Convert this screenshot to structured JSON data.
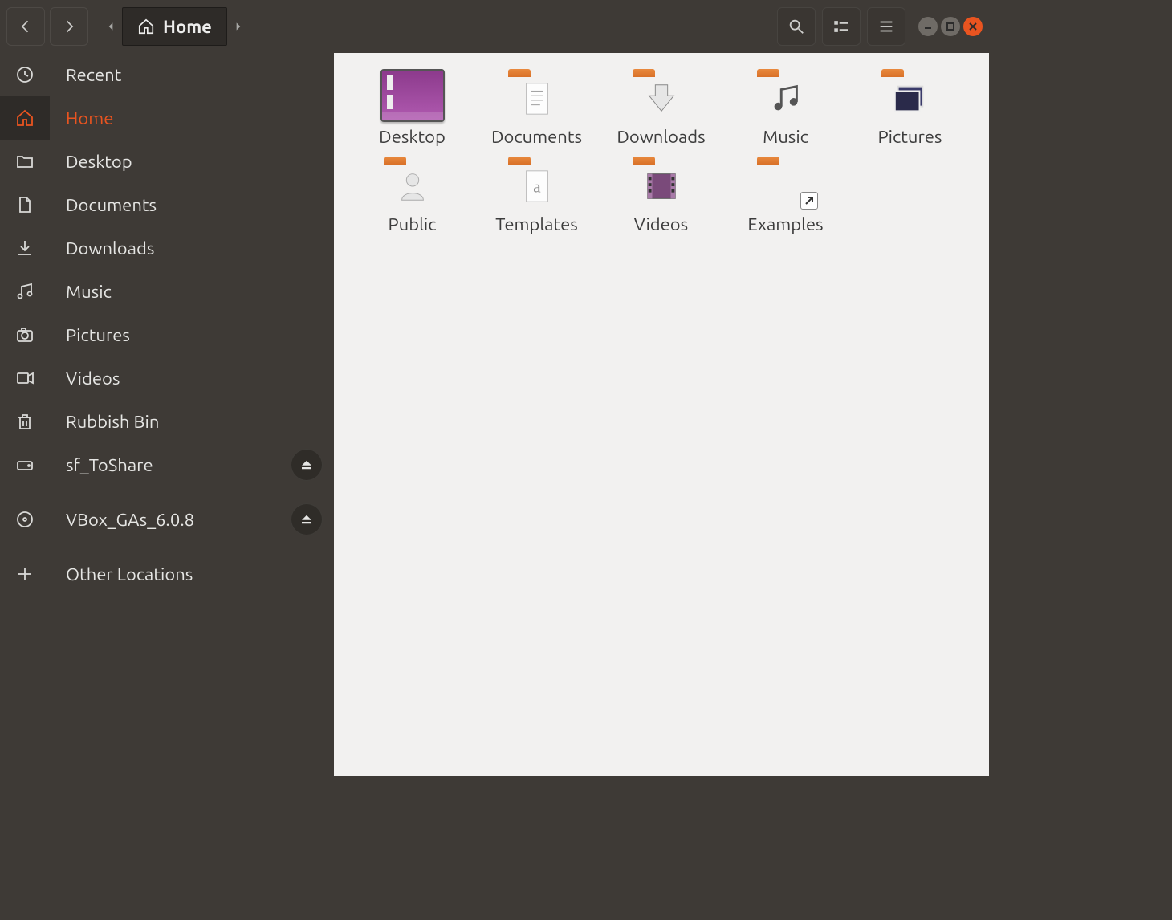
{
  "toolbar": {
    "path_segment": "Home"
  },
  "sidebar": {
    "items": [
      {
        "label": "Recent",
        "icon": "clock",
        "active": false,
        "ejectable": false
      },
      {
        "label": "Home",
        "icon": "home",
        "active": true,
        "ejectable": false
      },
      {
        "label": "Desktop",
        "icon": "folder",
        "active": false,
        "ejectable": false
      },
      {
        "label": "Documents",
        "icon": "document",
        "active": false,
        "ejectable": false
      },
      {
        "label": "Downloads",
        "icon": "download",
        "active": false,
        "ejectable": false
      },
      {
        "label": "Music",
        "icon": "music",
        "active": false,
        "ejectable": false
      },
      {
        "label": "Pictures",
        "icon": "camera",
        "active": false,
        "ejectable": false
      },
      {
        "label": "Videos",
        "icon": "video",
        "active": false,
        "ejectable": false
      },
      {
        "label": "Rubbish Bin",
        "icon": "trash",
        "active": false,
        "ejectable": false
      },
      {
        "label": "sf_ToShare",
        "icon": "drive",
        "active": false,
        "ejectable": true
      },
      {
        "label": "VBox_GAs_6.0.8",
        "icon": "disc",
        "active": false,
        "ejectable": true
      },
      {
        "label": "Other Locations",
        "icon": "plus",
        "active": false,
        "ejectable": false
      }
    ]
  },
  "content": {
    "folders": [
      {
        "label": "Desktop",
        "type": "desktop"
      },
      {
        "label": "Documents",
        "type": "folder",
        "overlay": "document"
      },
      {
        "label": "Downloads",
        "type": "folder",
        "overlay": "download"
      },
      {
        "label": "Music",
        "type": "folder",
        "overlay": "music"
      },
      {
        "label": "Pictures",
        "type": "folder",
        "overlay": "picture"
      },
      {
        "label": "Public",
        "type": "folder",
        "overlay": "person"
      },
      {
        "label": "Templates",
        "type": "folder",
        "overlay": "template"
      },
      {
        "label": "Videos",
        "type": "folder",
        "overlay": "video"
      },
      {
        "label": "Examples",
        "type": "folder",
        "overlay": "link"
      }
    ]
  }
}
